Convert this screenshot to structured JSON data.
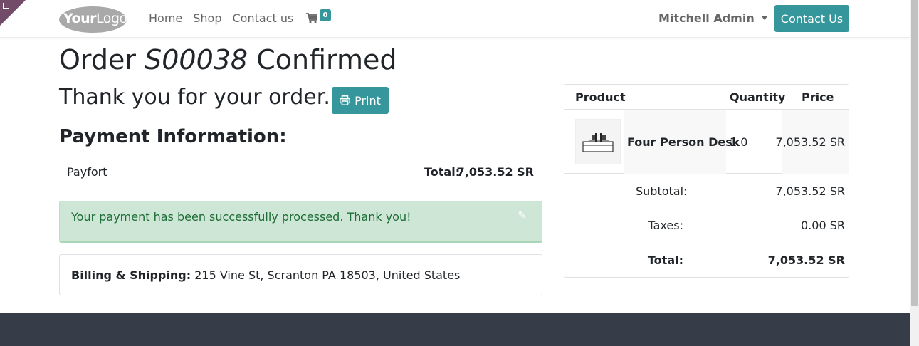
{
  "header": {
    "logo_text_bold": "Your",
    "logo_text": "Logo",
    "nav": [
      "Home",
      "Shop",
      "Contact us"
    ],
    "cart_count": "0",
    "user_name": "Mitchell Admin",
    "contact_button": "Contact Us"
  },
  "order": {
    "title_prefix": "Order",
    "order_number": "S00038",
    "title_suffix": "Confirmed",
    "thanks": "Thank you for your order.",
    "print_label": "Print"
  },
  "payment": {
    "heading": "Payment Information:",
    "method": "Payfort",
    "total_label": "Total:",
    "total_value": "7,053.52 SR",
    "success_message": "Your payment has been successfully processed. Thank you!"
  },
  "billing": {
    "label": "Billing & Shipping:",
    "address": "215 Vine St, Scranton PA 18503, United States"
  },
  "summary": {
    "columns": [
      "Product",
      "Quantity",
      "Price"
    ],
    "item": {
      "name": "Four Person Desk",
      "quantity": "1.0",
      "price": "7,053.52 SR"
    },
    "subtotal_label": "Subtotal:",
    "subtotal_value": "7,053.52 SR",
    "taxes_label": "Taxes:",
    "taxes_value": "0.00 SR",
    "total_label": "Total:",
    "total_value": "7,053.52 SR"
  },
  "colors": {
    "primary": "#35979c",
    "success_bg": "#cde6d5",
    "success_text": "#1c6c36",
    "footer": "#373d48",
    "corner": "#714B67"
  }
}
